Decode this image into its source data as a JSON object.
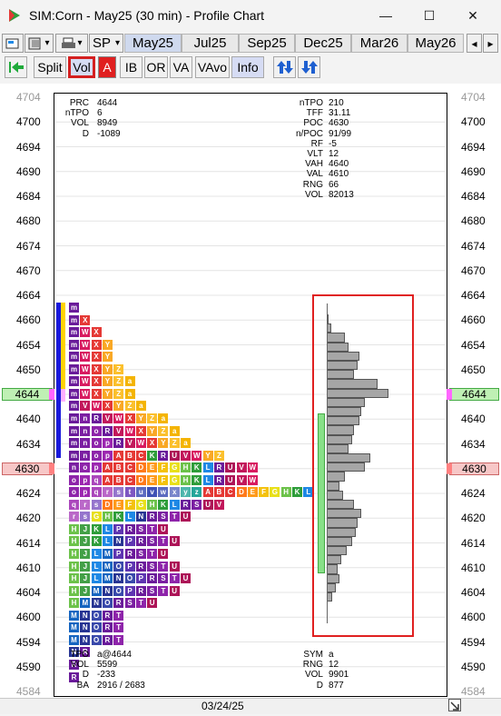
{
  "window": {
    "title": "SIM:Corn - May25 (30 min) - Profile Chart",
    "minimize": "—",
    "maximize": "☐",
    "close": "✕"
  },
  "toolbar": {
    "symbol": "SP",
    "dropdown_arrow": "▾",
    "tabs": [
      "May25",
      "Jul25",
      "Sep25",
      "Dec25",
      "Mar26",
      "May26"
    ],
    "active_tab": "May25",
    "nav_left": "◂",
    "nav_right": "▸"
  },
  "tools": {
    "split": "Split",
    "vol": "Vol",
    "a": "A",
    "ib": "IB",
    "or": "OR",
    "va": "VA",
    "vavo": "VAvo",
    "info": "Info"
  },
  "price_axis": {
    "labels": [
      "4704",
      "4700",
      "4694",
      "4690",
      "4684",
      "4680",
      "4674",
      "4670",
      "4664",
      "4660",
      "4654",
      "4650",
      "4644",
      "4640",
      "4634",
      "4630",
      "4624",
      "4620",
      "4614",
      "4610",
      "4604",
      "4600",
      "4594",
      "4590",
      "4584"
    ],
    "highlight_green": "4644",
    "highlight_red": "4630"
  },
  "info_top_left": {
    "labels": [
      "PRC",
      "nTPO",
      "VOL",
      "D"
    ],
    "values": [
      "4644",
      "6",
      "8949",
      "-1089"
    ]
  },
  "info_top_right": {
    "labels": [
      "nTPO",
      "TFF",
      "POC",
      "n/POC",
      "RF",
      "VLT",
      "VAH",
      "VAL",
      "RNG",
      "VOL"
    ],
    "values": [
      "210",
      "31.11",
      "4630",
      "91/99",
      "-5",
      "12",
      "4640",
      "4610",
      "66",
      "82013"
    ]
  },
  "info_bottom_left": {
    "labels": [
      "TPO",
      "VOL",
      "D",
      "BA"
    ],
    "values": [
      "a@4644",
      "5599",
      "-233",
      "2916 / 2683"
    ]
  },
  "info_bottom_right": {
    "labels": [
      "SYM",
      "RNG",
      "VOL",
      "D"
    ],
    "values": [
      "a",
      "12",
      "9901",
      "877"
    ]
  },
  "date_label": "03/24/25",
  "profile_rows": [
    "m",
    "mX",
    "mWX",
    "mWXY",
    "mWXY",
    "mWXYZ",
    "mWXYZa",
    "mWXYZa",
    "mVWXYZa",
    "mnRVWXYZa",
    "mnoRVWXYZa",
    "mnopRVWXYZa",
    "mnopABCKRUVWYZ",
    "nopABCDEFGHKLRUVW",
    "opqABCDEFGHKLRUVW",
    "opqrstuvwxyzABCDEFGHKLRUVW",
    "qrsDEFGHKLRSUV",
    "rsGHKLNRSTU",
    "HJKLPRSTU",
    "HJKLNPRSTU",
    "HJLMPRSTU",
    "HJLMOPRSTU",
    "HJLMNOPRSTU",
    "HJMNOPRSTU",
    "HMNORSTU",
    "MNORT",
    "MNORT",
    "MNORT",
    "NR",
    "R",
    "R"
  ],
  "volume_rows": [
    2,
    5,
    20,
    24,
    36,
    34,
    30,
    56,
    68,
    42,
    38,
    36,
    30,
    28,
    24,
    48,
    42,
    20,
    14,
    18,
    30,
    38,
    34,
    32,
    28,
    22,
    16,
    12,
    14,
    10,
    6
  ],
  "profile_colors": {
    "A": "#e53935",
    "B": "#e53935",
    "C": "#e53935",
    "D": "#ff7a1a",
    "E": "#ff9a1a",
    "F": "#f4c20d",
    "G": "#e8e01a",
    "H": "#6cc24a",
    "J": "#43a047",
    "K": "#2e9d3a",
    "L": "#1e88e5",
    "M": "#1565c0",
    "N": "#283593",
    "O": "#3949ab",
    "P": "#5e35b1",
    "R": "#6a1b9a",
    "S": "#7b1fa2",
    "T": "#8e24aa",
    "U": "#ad1457",
    "V": "#c2185b",
    "W": "#d81b60",
    "X": "#e53935",
    "Y": "#f9a825",
    "Z": "#fbc02d",
    "a": "#f4b400",
    "m": "#6a1b9a",
    "n": "#7b1fa2",
    "o": "#8e24aa",
    "p": "#9c27b0",
    "q": "#ab47bc",
    "r": "#ba68c8",
    "s": "#9575cd",
    "t": "#7e57c2",
    "u": "#5c6bc0",
    "v": "#3f51b5",
    "w": "#5c6bc0",
    "x": "#7986cb",
    "y": "#4db6ac",
    "z": "#26a69a"
  },
  "highlight_box_color": "#e02020",
  "value_area_color": "#88e088"
}
